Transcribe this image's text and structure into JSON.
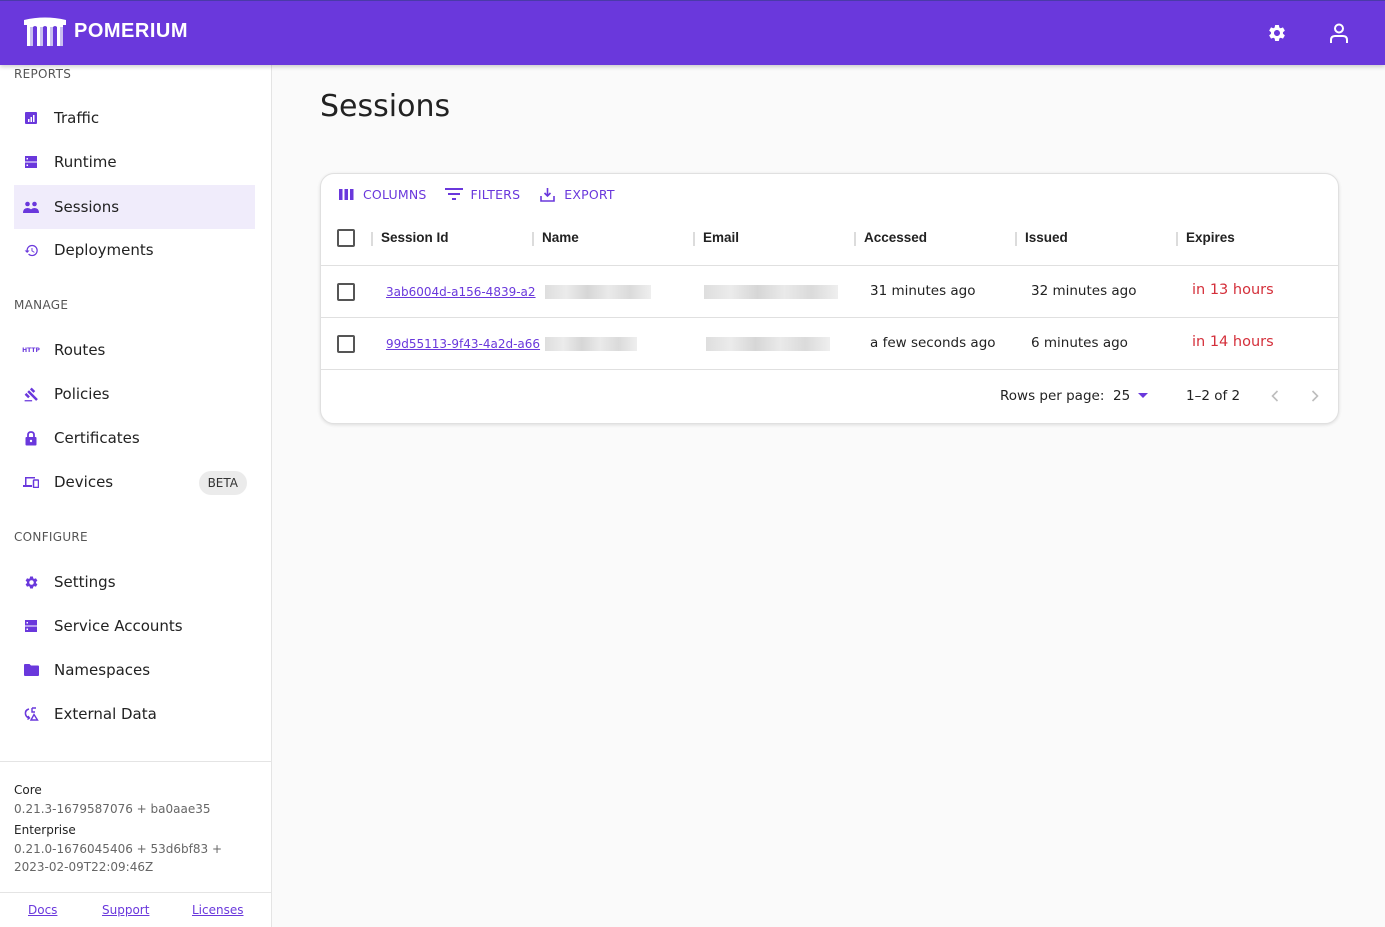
{
  "app": {
    "brand": "POMERIUM",
    "brand_color": "#6a38dc"
  },
  "appbar": {
    "settings_icon": "gear-icon",
    "account_icon": "person-icon"
  },
  "sidebar": {
    "sections": [
      {
        "label": "REPORTS",
        "items": [
          {
            "label": "Traffic",
            "icon": "bar-chart-icon"
          },
          {
            "label": "Runtime",
            "icon": "storage-icon"
          },
          {
            "label": "Sessions",
            "icon": "people-icon",
            "active": true
          },
          {
            "label": "Deployments",
            "icon": "history-icon"
          }
        ]
      },
      {
        "label": "MANAGE",
        "items": [
          {
            "label": "Routes",
            "icon": "http-icon"
          },
          {
            "label": "Policies",
            "icon": "gavel-icon"
          },
          {
            "label": "Certificates",
            "icon": "lock-icon"
          },
          {
            "label": "Devices",
            "icon": "devices-icon",
            "badge": "BETA"
          }
        ]
      },
      {
        "label": "CONFIGURE",
        "items": [
          {
            "label": "Settings",
            "icon": "gear-icon"
          },
          {
            "label": "Service Accounts",
            "icon": "storage-icon"
          },
          {
            "label": "Namespaces",
            "icon": "folder-icon"
          },
          {
            "label": "External Data",
            "icon": "sync-data-icon"
          }
        ]
      }
    ],
    "versions": {
      "core_label": "Core",
      "core_value": "0.21.3-1679587076 + ba0aae35",
      "enterprise_label": "Enterprise",
      "enterprise_value": "0.21.0-1676045406 + 53d6bf83 + 2023-02-09T22:09:46Z"
    },
    "footer_links": {
      "docs": "Docs",
      "support": "Support",
      "licenses": "Licenses"
    }
  },
  "main": {
    "title": "Sessions",
    "toolbar": {
      "columns": "COLUMNS",
      "filters": "FILTERS",
      "export": "EXPORT"
    },
    "table": {
      "columns": [
        "Session Id",
        "Name",
        "Email",
        "Accessed",
        "Issued",
        "Expires"
      ],
      "rows": [
        {
          "session_id": "3ab6004d-a156-4839-a2",
          "name": "[redacted]",
          "email": "[redacted]",
          "accessed": "31 minutes ago",
          "issued": "32 minutes ago",
          "expires": "in 13 hours"
        },
        {
          "session_id": "99d55113-9f43-4a2d-a66",
          "name": "[redacted]",
          "email": "[redacted]",
          "accessed": "a few seconds ago",
          "issued": "6 minutes ago",
          "expires": "in 14 hours"
        }
      ]
    },
    "pagination": {
      "rows_per_page_label": "Rows per page:",
      "rows_per_page_value": "25",
      "range": "1–2 of 2"
    }
  }
}
